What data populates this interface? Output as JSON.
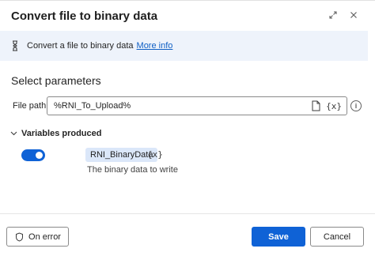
{
  "dialog": {
    "title": "Convert file to binary data",
    "expand_icon": "expand-diagonal-icon",
    "close_icon": "close-icon"
  },
  "info": {
    "text": "Convert a file to binary data",
    "link": "More info",
    "icon": "action-indicator-icon"
  },
  "params": {
    "section_title": "Select parameters",
    "file_path": {
      "label": "File path:",
      "value": "%RNI_To_Upload%",
      "file_icon": "file-icon",
      "var_button": "{x}",
      "help_icon": "info-circle-icon"
    }
  },
  "variables": {
    "header": "Variables produced",
    "toggle_on": true,
    "name": "RNI_BinaryData",
    "var_button": "{x}",
    "description": "The binary data to write"
  },
  "footer": {
    "on_error": "On error",
    "save": "Save",
    "cancel": "Cancel"
  },
  "colors": {
    "accent": "#0f62d6",
    "info_bg": "#eef3fb",
    "chip_bg": "#dbe7f9",
    "link": "#0f5fc4"
  }
}
